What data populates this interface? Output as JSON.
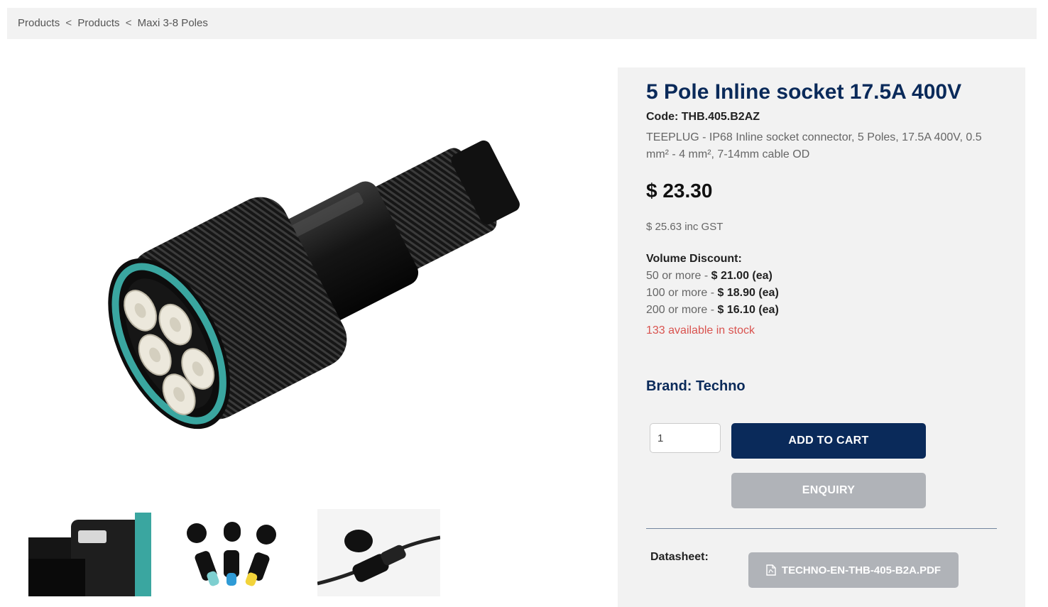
{
  "breadcrumb": {
    "items": [
      "Products",
      "Products",
      "Maxi 3-8 Poles"
    ],
    "separator": "<"
  },
  "product": {
    "title": "5 Pole Inline socket 17.5A 400V",
    "code": "Code: THB.405.B2AZ",
    "description": "TEEPLUG - IP68 Inline socket connector, 5 Poles, 17.5A 400V, 0.5 mm² - 4 mm², 7-14mm cable OD",
    "price": "$ 23.30",
    "price_gst": "$ 25.63 inc GST",
    "volume_discount": {
      "title": "Volume Discount:",
      "tiers": [
        {
          "qty": "50 or more - ",
          "price": "$ 21.00 (ea)"
        },
        {
          "qty": "100 or more - ",
          "price": "$ 18.90 (ea)"
        },
        {
          "qty": "200 or more - ",
          "price": "$ 16.10 (ea)"
        }
      ]
    },
    "stock": "133 available in stock",
    "brand": "Brand: Techno"
  },
  "purchase": {
    "quantity": "1",
    "add_to_cart_label": "ADD TO CART",
    "enquiry_label": "ENQUIRY"
  },
  "datasheet": {
    "label": "Datasheet:",
    "file": "TECHNO-EN-THB-405-B2A.PDF",
    "icon": "pdf-file-icon"
  },
  "colors": {
    "navy": "#0a2a5a",
    "panel": "#f2f2f2",
    "disabled_button": "#b0b3b8",
    "stock_red": "#d9534f",
    "seal_teal": "#3aa6a0"
  }
}
